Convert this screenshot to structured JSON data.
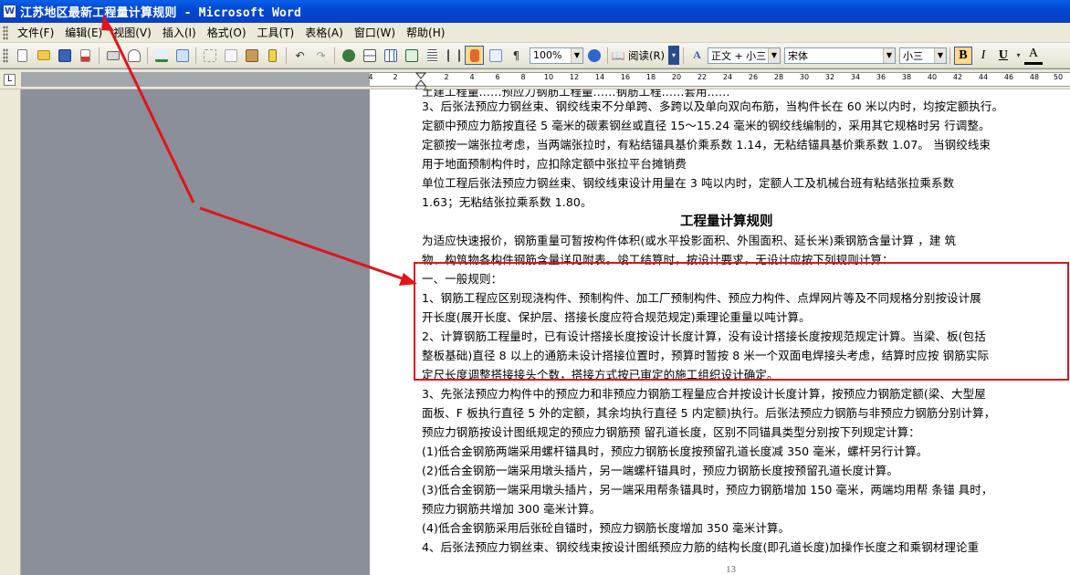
{
  "window": {
    "title": "江苏地区最新工程量计算规则 - Microsoft Word",
    "app_icon": "W"
  },
  "menu": [
    "文件(F)",
    "编辑(E)",
    "视图(V)",
    "插入(I)",
    "格式(O)",
    "工具(T)",
    "表格(A)",
    "窗口(W)",
    "帮助(H)"
  ],
  "toolbar": {
    "zoom": "100%",
    "read_label": "阅读(R)",
    "style": "正文 + 小三",
    "font": "宋体",
    "size": "小三",
    "bold": "B",
    "italic": "I",
    "underline": "U",
    "font_color_letter": "A",
    "char_label": "A"
  },
  "ruler": {
    "corner": "L",
    "ticks": [
      "4",
      "2",
      "2",
      "4",
      "6",
      "8",
      "10",
      "12",
      "14",
      "16",
      "18",
      "20",
      "22",
      "24",
      "26",
      "28",
      "30",
      "32",
      "34",
      "36",
      "38",
      "40",
      "42",
      "44",
      "46",
      "48",
      "50"
    ]
  },
  "document": {
    "clipped_top": "土建工程量……预应力钢筋工程量……钢筋工程……套用……",
    "lines_before": [
      "3、后张法预应力钢丝束、钢绞线束不分单跨、多跨以及单向双向布筋，当构件长在 60 米以内时，均按定额执行。",
      "定额中预应力筋按直径 5 毫米的碳素钢丝或直径 15～15.24 毫米的钢绞线编制的，采用其它规格时另  行调整。",
      "定额按一端张拉考虑，当两端张拉时，有粘结锚具基价乘系数 1.14，无粘结锚具基价乘系数 1.07。  当钢绞线束",
      "用于地面预制构件时，应扣除定额中张拉平台摊销费",
      "    单位工程后张法预应力钢丝束、钢绞线束设计用量在  3  吨以内时，定额人工及机械台班有粘结张拉乘系数",
      "1.63；无粘结张拉乘系数 1.80。"
    ],
    "heading": "工程量计算规则",
    "lines_mid": [
      "    为适应快速报价，钢筋重量可暂按构件体积(或水平投影面积、外围面积、延长米)乘钢筋含量计算 ，建 筑",
      "物、构筑物各构件钢筋含量详见附表。竣工结算时，按设计要求，无设计应按下列规则计算："
    ],
    "lines_boxed": [
      "    一、一般规则：",
      "1、钢筋工程应区别现浇构件、预制构件、加工厂预制构件、预应力构件、点焊网片等及不同规格分别按设计展",
      "开长度(展开长度、保护层、搭接长度应符合规范规定)乘理论重量以吨计算。",
      "2、计算钢筋工程量时，已有设计搭接长度按设计长度计算，没有设计搭接长度按规范规定计算。当梁、板(包括",
      "整板基础)直径 8 以上的通筋未设计搭接位置时，预算时暂按 8 米一个双面电焊接头考虑，结算时应按  钢筋实际",
      "定尺长度调整搭接接头个数，搭接方式按已审定的施工组织设计确定。"
    ],
    "lines_after": [
      "3、先张法预应力构件中的预应力和非预应力钢筋工程量应合并按设计长度计算，按预应力钢筋定额(梁、大型屋",
      "面板、F 板执行直径 5 外的定额，其余均执行直径 5 内定额)执行。后张法预应力钢筋与非预应力钢筋分别计算，",
      "预应力钢筋按设计图纸规定的预应力钢筋预  留孔道长度，区别不同锚具类型分别按下列规定计算：",
      "(1)低合金钢筋两端采用螺杆锚具时，预应力钢筋长度按预留孔道长度减 350 毫米，螺杆另行计算。",
      "(2)低合金钢筋一端采用墩头插片，另一端螺杆锚具时，预应力钢筋长度按预留孔道长度计算。",
      "(3)低合金钢筋一端采用墩头插片，另一端采用帮条锚具时，预应力钢筋增加 150 毫米，两端均用帮  条锚  具时，",
      "预应力钢筋共增加 300 毫米计算。",
      "(4)低合金钢筋采用后张砼自锚时，预应力钢筋长度增加 350 毫米计算。",
      "4、后张法预应力钢丝束、钢绞线束按设计图纸预应力筋的结构长度(即孔道长度)加操作长度之和乘钢材理论重"
    ],
    "page_number": "13"
  },
  "annotation": {
    "color": "#e0141c"
  }
}
